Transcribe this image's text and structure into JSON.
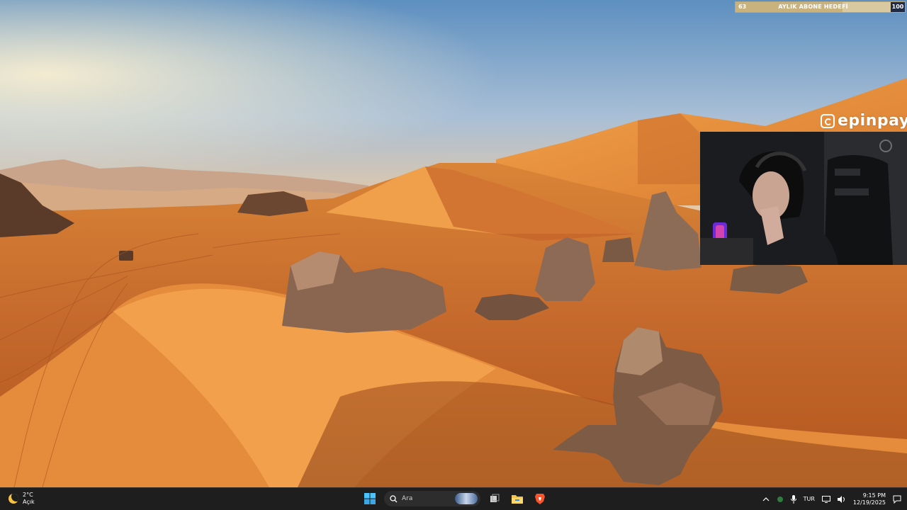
{
  "overlay": {
    "goal": {
      "current": "63",
      "title": "AYLIK ABONE HEDEFİ",
      "target": "100",
      "progress": 0.63
    },
    "sponsor": {
      "name": "epinpay",
      "icon": "epinpay-logo-icon"
    }
  },
  "taskbar": {
    "weather": {
      "temperature": "2°C",
      "condition": "Açık",
      "icon": "moon-icon"
    },
    "start_icon": "windows-start-icon",
    "search": {
      "placeholder": "Ara",
      "icon": "search-icon"
    },
    "apps": [
      "task-view-icon",
      "file-explorer-icon",
      "brave-browser-icon"
    ],
    "tray": {
      "language": "TUR",
      "time": "9:15 PM",
      "date": "12/19/2025",
      "icons": [
        "chevron-up-icon",
        "security-icon",
        "microphone-icon",
        "network-icon",
        "volume-icon",
        "notification-icon"
      ]
    }
  },
  "colors": {
    "taskbar_bg": "#1e1e1f",
    "goal_end_bg": "#1f2a44",
    "start_blue": "#4cc2ff"
  }
}
